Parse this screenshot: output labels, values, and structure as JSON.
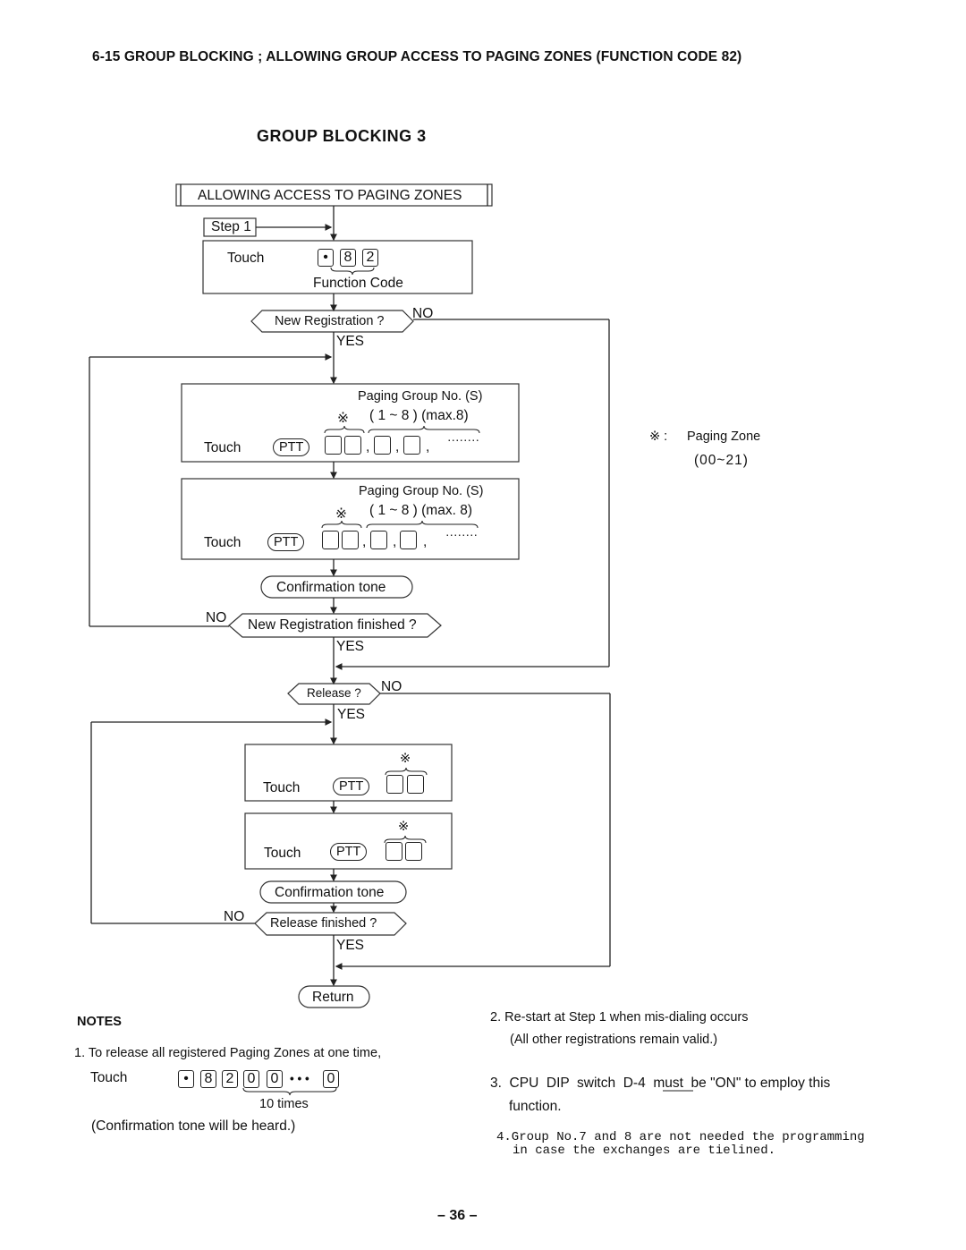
{
  "header": {
    "section_title": "6-15  GROUP BLOCKING ; ALLOWING GROUP ACCESS TO PAGING ZONES (FUNCTION CODE 82)",
    "diagram_title": "GROUP  BLOCKING  3"
  },
  "flow": {
    "start_box": "ALLOWING ACCESS TO PAGING ZONES",
    "step_label": "Step 1",
    "step1": {
      "touch": "Touch",
      "keys": [
        "•",
        "8",
        "2"
      ],
      "brace_label": "Function Code"
    },
    "decision_new_registration": "New Registration ?",
    "decision_new_registration_finished": "New Registration finished ?",
    "decision_release": "Release ?",
    "decision_release_finished": "Release finished  ?",
    "yes": "YES",
    "no": "NO",
    "reg_box_1": {
      "touch": "Touch",
      "ptt": "PTT",
      "group_label": "Paging Group No. (S)",
      "range": "( 1 ~ 8 ) (max.8)",
      "zone_mark": "※",
      "separator": ",",
      "ellipsis": "········"
    },
    "reg_box_2": {
      "touch": "Touch",
      "ptt": "PTT",
      "group_label": "Paging Group No. (S)",
      "range": "( 1 ~ 8 )  (max. 8)",
      "zone_mark": "※",
      "separator": ",",
      "ellipsis": "········"
    },
    "confirmation_tone_1": "Confirmation  tone",
    "release_box_1": {
      "touch": "Touch",
      "ptt": "PTT",
      "zone_mark": "※"
    },
    "release_box_2": {
      "touch": "Touch",
      "ptt": "PTT",
      "zone_mark": "※"
    },
    "confirmation_tone_2": "Confirmation tone",
    "return": "Return"
  },
  "legend": {
    "symbol": "※ :",
    "label": "Paging Zone",
    "range": "(00~21)"
  },
  "notes": {
    "heading": "NOTES",
    "note1": {
      "text": "1.  To release all registered Paging Zones at one time,",
      "touch": "Touch",
      "keys": [
        "•",
        "8",
        "2",
        "0",
        "0",
        "0"
      ],
      "dots": "• • •",
      "brace_label": "10 times",
      "after": "(Confirmation tone will be heard.)"
    },
    "note2": {
      "line1": "2.  Re-start at Step 1 when mis-dialing occurs",
      "line2": "(All other registrations remain valid.)"
    },
    "note3": {
      "prefix": "3.  CPU  DIP  switch  D-4  ",
      "emphasis": "must",
      "suffix": "  be \"ON\" to employ this",
      "line2": "function."
    },
    "note4": {
      "line1": "4.Group No.7 and 8 are not needed the programming",
      "line2": "in case the exchanges are tielined."
    }
  },
  "footer": {
    "page_number": "– 36 –"
  }
}
